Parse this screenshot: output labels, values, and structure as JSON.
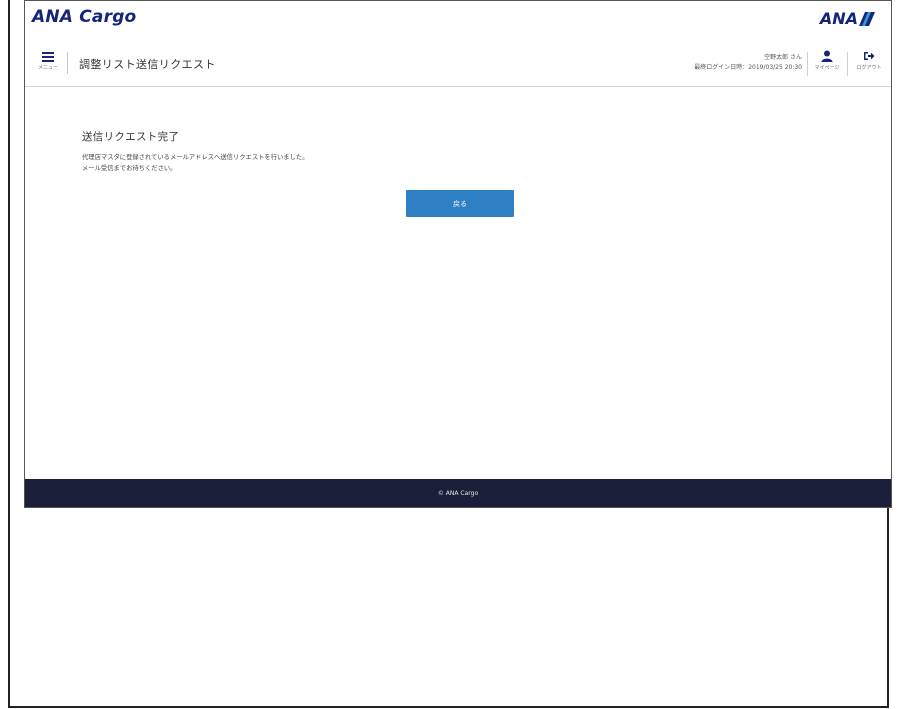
{
  "brand": {
    "logo_text": "ANA Cargo",
    "ana_logo_text": "ANA"
  },
  "header": {
    "menu_label": "メニュー",
    "page_title": "調整リスト送信リクエスト",
    "user_name": "空野太郎 さん",
    "last_login": "最終ログイン日時：2019/03/25 20:30",
    "mypage_label": "マイページ",
    "logout_label": "ログアウト"
  },
  "main": {
    "title": "送信リクエスト完了",
    "message_line1": "代理店マスタに登録されているメールアドレスへ送信リクエストを行いました。",
    "message_line2": "メール受信までお待ちください。",
    "back_button": "戻る"
  },
  "footer": {
    "copyright": "© ANA Cargo"
  },
  "colors": {
    "brand_navy": "#16257a",
    "button_blue": "#2f7fc4",
    "footer_bg": "#1c1f3a"
  },
  "icons": {
    "menu": "hamburger-icon",
    "mypage": "user-icon",
    "logout": "logout-icon",
    "ana_logo_stripe": "ana-stripe-icon"
  }
}
